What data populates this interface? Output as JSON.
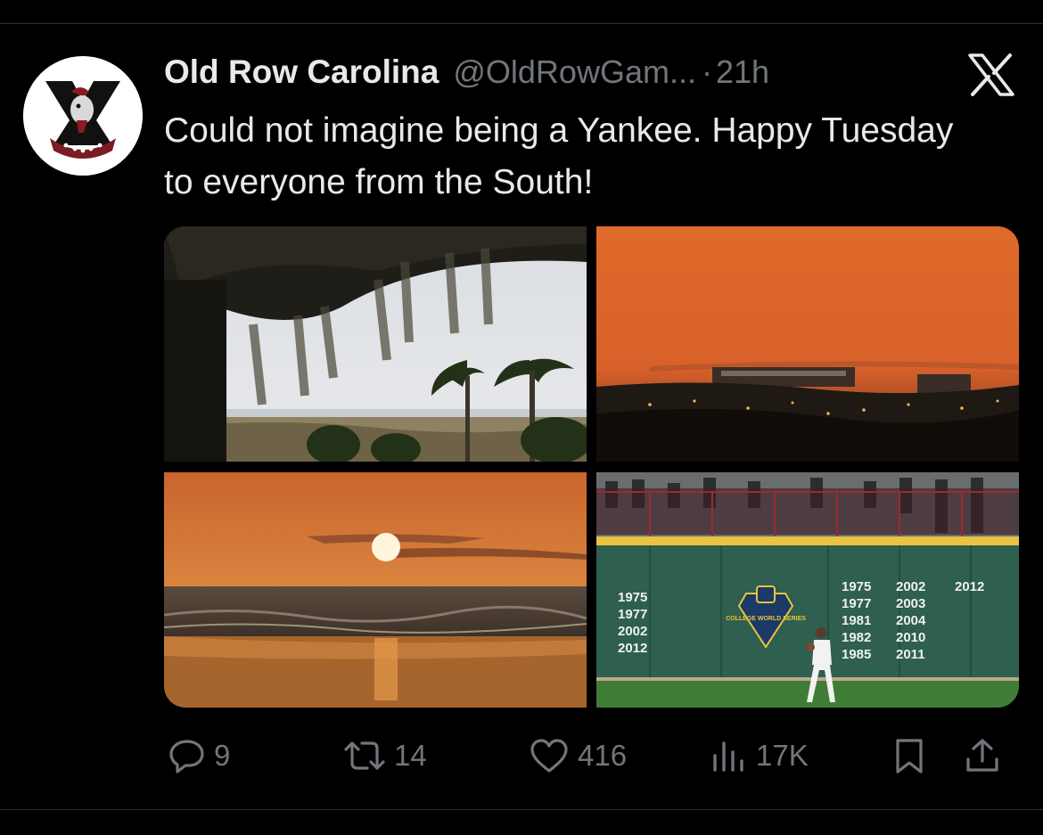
{
  "tweet": {
    "display_name": "Old Row Carolina",
    "handle": "@OldRowGam...",
    "separator": "·",
    "time": "21h",
    "text": "Could not imagine being a Yankee. Happy Tuesday to everyone from the South!"
  },
  "media": {
    "wall_years_left": [
      "1975",
      "1977",
      "2002",
      "2012"
    ],
    "wall_years_mid": [
      "1975",
      "1977",
      "1981",
      "1982",
      "1985"
    ],
    "wall_years_right": [
      "2002",
      "2003",
      "2004",
      "2010",
      "2011"
    ],
    "wall_year_far": "2012",
    "cws_logo_text": "COLLEGE WORLD SERIES"
  },
  "actions": {
    "replies": "9",
    "reposts": "14",
    "likes": "416",
    "views": "17K"
  },
  "icons": [
    "x-logo-icon",
    "reply-icon",
    "repost-icon",
    "like-icon",
    "views-icon",
    "bookmark-icon",
    "share-icon"
  ],
  "colors": {
    "background": "#000000",
    "text_primary": "#e7e9ea",
    "text_secondary": "#71767b",
    "divider": "#2f3336"
  }
}
